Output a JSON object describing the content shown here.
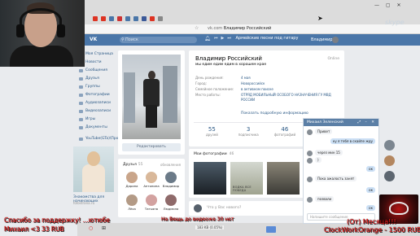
{
  "browser": {
    "url_domain": "vk.com",
    "url_title": "Владимир Российский",
    "net_speed": "183 KB (0.05%)",
    "overlay_logo": "skype"
  },
  "vk": {
    "logo": "VK",
    "search_placeholder": "Поиск",
    "now_playing": "Армейские песни под гитару",
    "header_user": "Владимир"
  },
  "menu": [
    {
      "label": "Моя Страница"
    },
    {
      "label": "Новости"
    },
    {
      "label": "Сообщения"
    },
    {
      "label": "Друзья"
    },
    {
      "label": "Группы"
    },
    {
      "label": "Фотографии"
    },
    {
      "label": "Аудиозаписи"
    },
    {
      "label": "Видеозаписи"
    },
    {
      "label": "Игры"
    },
    {
      "label": "Документы"
    },
    {
      "label": "YouTube(GTa)\\Про"
    }
  ],
  "ad": {
    "title": "Знакомства для начинающих",
    "subtitle": "fotostrana.ru"
  },
  "profile": {
    "name": "Владимир Российский",
    "status": "мы едим едим едим в хорошем крае",
    "online": "Online",
    "edit_button": "Редактировать",
    "show_details": "Показать подробную информацию",
    "info": [
      {
        "label": "День рождения:",
        "value": "4 мая"
      },
      {
        "label": "Город:",
        "value": "Новороссийск"
      },
      {
        "label": "Семейное положение:",
        "value": "в активном поиске"
      },
      {
        "label": "Место работы:",
        "value": "ОТРЯД МОБИЛЬНЫЙ ОСОБОГО НАЗНАЧЕНИЯ ГУ МВД РОССИИ"
      }
    ],
    "counters": [
      {
        "num": "55",
        "label": "друзей"
      },
      {
        "num": "3",
        "label": "подписчика"
      },
      {
        "num": "46",
        "label": "фотографий"
      },
      {
        "num": "19",
        "label": "видеозаписей"
      }
    ]
  },
  "photos": {
    "header": "Мои фотографии",
    "count": "46",
    "captions": [
      "",
      "ВОДКА ВСЕ ПОБЕДА",
      "",
      ""
    ]
  },
  "friends": {
    "header": "Друзья",
    "count": "55",
    "updates_label": "обновления",
    "list": [
      {
        "name": "Дарина",
        "color": "#c9a58a"
      },
      {
        "name": "Антонина",
        "color": "#d9b89a"
      },
      {
        "name": "Владимир",
        "color": "#6b7a88"
      },
      {
        "name": "Лёха",
        "color": "#b39a86"
      },
      {
        "name": "Татьяна",
        "color": "#d3a2a0"
      },
      {
        "name": "Людмила",
        "color": "#8f6a6a"
      }
    ]
  },
  "post": {
    "placeholder": "Что у Вас нового?"
  },
  "chat": {
    "title": "Михаил Зеленский",
    "messages": [
      {
        "text": "Привет",
        "dir": "in"
      },
      {
        "text": "ну я тебя в скайпе жду",
        "dir": "out"
      },
      {
        "text": "через мин 15",
        "dir": "in"
      },
      {
        "text": ")",
        "dir": "in"
      },
      {
        "text": "ок",
        "dir": "out"
      },
      {
        "text": "Пока ажалость занят",
        "dir": "in"
      },
      {
        "text": "ок",
        "dir": "out"
      },
      {
        "text": "позвали",
        "dir": "in"
      },
      {
        "text": "ок",
        "dir": "out"
      }
    ],
    "input_placeholder": "Напишите сообщение"
  },
  "overlay": {
    "ticker1": "Спасибо за поддержку! ...ютюбе",
    "ticker2": "Михаил <3 33 RUB",
    "ticker3": "(От) Месяца!!!",
    "ticker4": "ClockWorkOrange - 1500 RUB",
    "ticker5": "На Вещь до видеоже 30 нет"
  },
  "colors": {
    "vk_blue": "#4a76a8",
    "link": "#2a5885",
    "ticker_red": "#ff2020"
  }
}
